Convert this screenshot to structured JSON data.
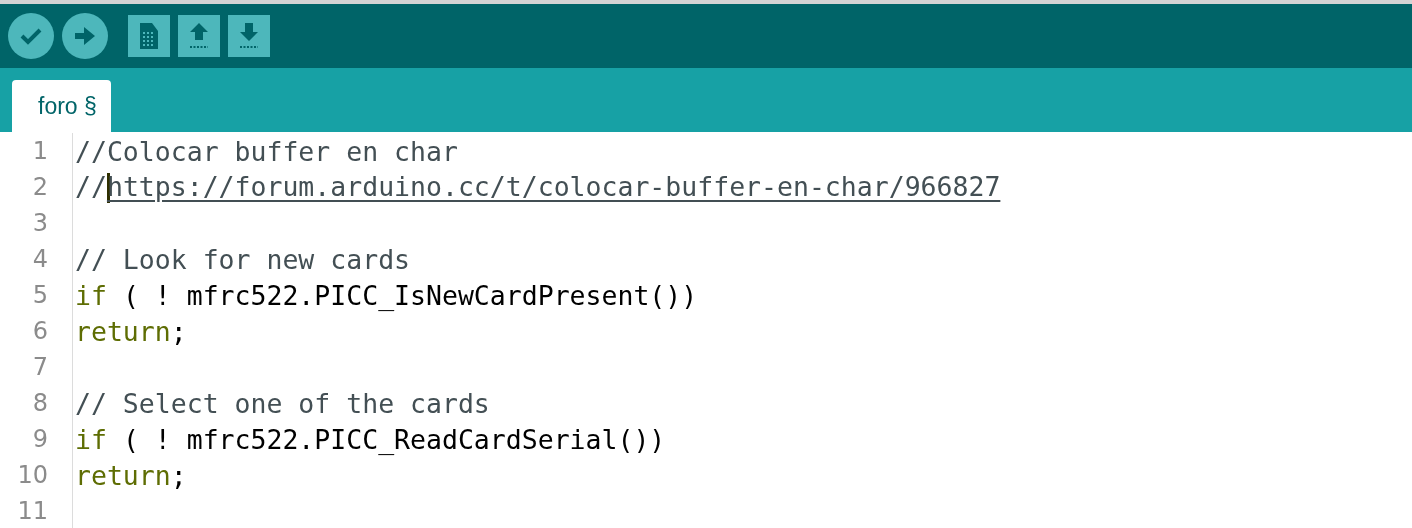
{
  "toolbar": {
    "buttons": [
      {
        "kind": "verify"
      },
      {
        "kind": "upload"
      },
      {
        "kind": "new"
      },
      {
        "kind": "open"
      },
      {
        "kind": "save"
      }
    ]
  },
  "tabs": [
    {
      "label": "foro §",
      "selected": true
    }
  ],
  "editor": {
    "lines": [
      {
        "number": "1",
        "tokens": [
          {
            "kind": "comment",
            "text": "//Colocar buffer en char"
          }
        ]
      },
      {
        "number": "2",
        "tokens": [
          {
            "kind": "comment",
            "text": "//"
          },
          {
            "kind": "link",
            "text": "https://forum.arduino.cc/t/colocar-buffer-en-char/966827",
            "caret": true
          }
        ]
      },
      {
        "number": "3"
      },
      {
        "number": "4",
        "tokens": [
          {
            "kind": "comment",
            "text": "// Look for new cards"
          }
        ]
      },
      {
        "number": "5",
        "tokens": [
          {
            "kind": "keyword",
            "text": "if"
          },
          {
            "kind": "plain",
            "text": " ( ! mfrc522.PICC_IsNewCardPresent())"
          }
        ]
      },
      {
        "number": "6",
        "tokens": [
          {
            "kind": "keyword",
            "text": "return"
          },
          {
            "kind": "plain",
            "text": ";"
          }
        ]
      },
      {
        "number": "7"
      },
      {
        "number": "8",
        "tokens": [
          {
            "kind": "comment",
            "text": "// Select one of the cards"
          }
        ]
      },
      {
        "number": "9",
        "tokens": [
          {
            "kind": "keyword",
            "text": "if"
          },
          {
            "kind": "plain",
            "text": " ( ! mfrc522.PICC_ReadCardSerial())"
          }
        ]
      },
      {
        "number": "10",
        "tokens": [
          {
            "kind": "keyword",
            "text": "return"
          },
          {
            "kind": "plain",
            "text": ";"
          }
        ]
      },
      {
        "number": "11"
      }
    ]
  }
}
